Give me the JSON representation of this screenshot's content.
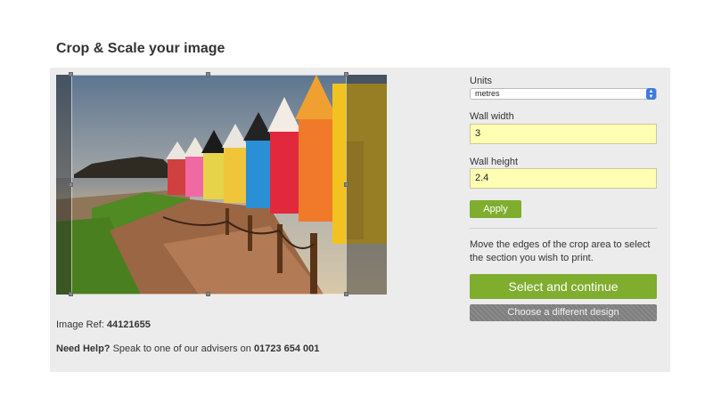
{
  "page": {
    "title": "Crop & Scale your image"
  },
  "image": {
    "ref_label": "Image Ref:",
    "ref_value": "44121655"
  },
  "help": {
    "label": "Need Help?",
    "text": "Speak to one of our advisers on",
    "phone": "01723 654 001"
  },
  "form": {
    "units_label": "Units",
    "units_value": "metres",
    "wall_width_label": "Wall width",
    "wall_width_value": "3",
    "wall_height_label": "Wall height",
    "wall_height_value": "2.4",
    "apply_label": "Apply",
    "instructions": "Move the edges of the crop area to select the section you wish to print.",
    "select_continue_label": "Select and continue",
    "choose_design_label": "Choose a different design"
  },
  "colors": {
    "accent_green": "#7fad2e",
    "input_yellow": "#ffffb3",
    "panel_gray": "#ececec"
  }
}
